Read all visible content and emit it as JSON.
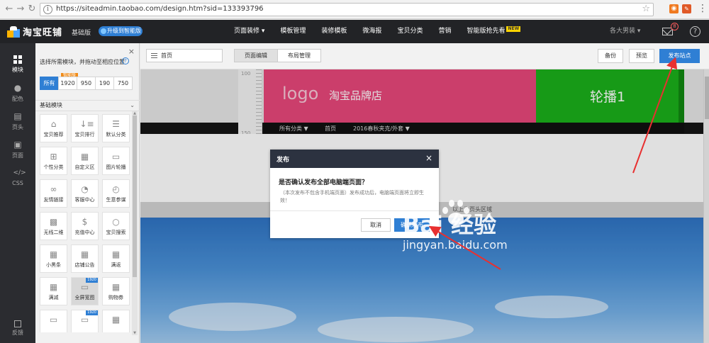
{
  "browser": {
    "url": "https://siteadmin.taobao.com/design.htm?sid=133393796",
    "back_icon": "back-arrow-icon",
    "forward_icon": "forward-arrow-icon"
  },
  "header": {
    "logo_text": "淘宝旺铺",
    "edition": "基础版",
    "upgrade_label": "升级到智能版",
    "nav": [
      "页面装修 ▾",
      "模板管理",
      "装修模板",
      "微海报",
      "宝贝分类",
      "营销",
      "智能版抢先看"
    ],
    "new_badge": "NEW",
    "store_select": "各大男装 ▾",
    "mail_count": "8",
    "help_glyph": "?"
  },
  "rail": {
    "items": [
      "模块",
      "配色",
      "页头",
      "页面",
      "CSS"
    ],
    "feedback": "反馈"
  },
  "panel": {
    "close_glyph": "×",
    "hint": "选择所需模块，并拖动至相应位置",
    "hint_glyph": "?",
    "size_tabs": [
      "所有",
      "1920",
      "950",
      "190",
      "750"
    ],
    "size_badge": "智能版",
    "section_title": "基础模块",
    "section_chevron": "⌄",
    "modules": [
      {
        "label": "宝贝推荐",
        "icon": "⌂"
      },
      {
        "label": "宝贝排行",
        "icon": "↓≡"
      },
      {
        "label": "默认分类",
        "icon": "☰"
      },
      {
        "label": "个性分类",
        "icon": "⊞"
      },
      {
        "label": "自定义区",
        "icon": "▦"
      },
      {
        "label": "图片轮播",
        "icon": "▭"
      },
      {
        "label": "友情链接",
        "icon": "∞"
      },
      {
        "label": "客服中心",
        "icon": "◔"
      },
      {
        "label": "生意参谋",
        "icon": "◴"
      },
      {
        "label": "无线二维",
        "icon": "▩"
      },
      {
        "label": "充值中心",
        "icon": "$"
      },
      {
        "label": "宝贝搜索",
        "icon": "○"
      },
      {
        "label": "小黑条",
        "icon": "▦"
      },
      {
        "label": "店铺公告",
        "icon": "▦"
      },
      {
        "label": "满返",
        "icon": "▦"
      },
      {
        "label": "满减",
        "icon": "▦"
      },
      {
        "label": "全屏宽图",
        "icon": "▭"
      },
      {
        "label": "购物券",
        "icon": "▦"
      },
      {
        "label": "",
        "icon": "▭"
      },
      {
        "label": "",
        "icon": "▭"
      },
      {
        "label": "",
        "icon": "▦"
      }
    ],
    "module_tag": "1920"
  },
  "toolbar": {
    "page_select": "首页",
    "tabs": [
      "页面编辑",
      "布局管理"
    ],
    "backup": "备份",
    "preview": "预览",
    "publish": "发布站点"
  },
  "canvas": {
    "ruler_labels": [
      "100",
      "150"
    ],
    "shop_logo": "logo",
    "shop_name": "淘宝品牌店",
    "carousel": "轮播1",
    "nav": [
      "所有分类 ▼",
      "首页",
      "2016春秋夹克/外套 ▼"
    ],
    "divider": "以上为页头区域"
  },
  "dialog": {
    "title": "发布",
    "close_glyph": "×",
    "question": "是否确认发布全部电脑端页面？",
    "note": "（本次发布不包含手机端页面）发布成功后，电脑端页面将立即生效！",
    "cancel": "取消",
    "confirm": "确认发布"
  },
  "watermark": {
    "brand": "Bai 经验",
    "site": "jingyan.baidu.com"
  },
  "colors": {
    "header_bg": "#222326",
    "accent_blue": "#2f7fd4",
    "banner_pink": "#e8477a",
    "carousel_green": "#1bb01b",
    "annotation_red": "#e83030"
  }
}
